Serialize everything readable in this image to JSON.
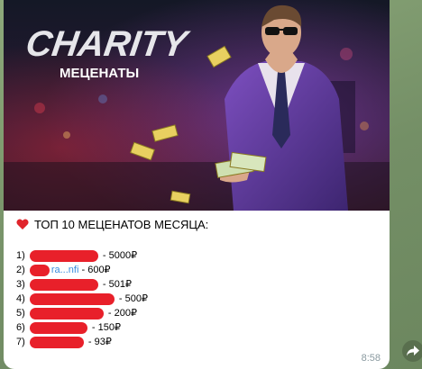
{
  "banner": {
    "logo_text": "CHARITY",
    "logo_subtitle": "МЕЦЕНАТЫ"
  },
  "message": {
    "heading": "ТОП 10 МЕЦЕНАТОВ МЕСЯЦА:",
    "entries": [
      {
        "rank": "1)",
        "amount": "- 5000₽"
      },
      {
        "rank": "2)",
        "link_fragment": "ra...nfi",
        "amount": "- 600₽"
      },
      {
        "rank": "3)",
        "amount": "- 501₽"
      },
      {
        "rank": "4)",
        "amount": "- 500₽"
      },
      {
        "rank": "5)",
        "amount": "- 200₽"
      },
      {
        "rank": "6)",
        "amount": "- 150₽"
      },
      {
        "rank": "7)",
        "amount": "- 93₽"
      }
    ],
    "time": "8:58"
  },
  "icons": {
    "heart": "red-heart-icon",
    "forward": "forward-arrow-icon"
  },
  "colors": {
    "redaction": "#e8202a",
    "link": "#3a8dde",
    "heart": "#e0242b"
  }
}
